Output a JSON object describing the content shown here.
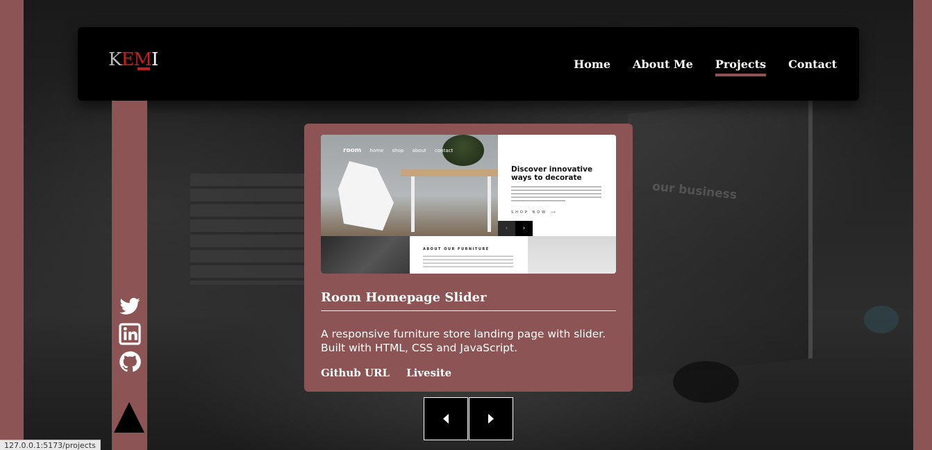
{
  "navbar": {
    "logo_letters": [
      "K",
      "E",
      "M",
      "I"
    ],
    "links": [
      {
        "label": "Home",
        "active": false
      },
      {
        "label": "About Me",
        "active": false
      },
      {
        "label": "Projects",
        "active": true
      },
      {
        "label": "Contact",
        "active": false
      }
    ]
  },
  "social": {
    "icons": [
      "twitter-icon",
      "linkedin-icon",
      "github-icon"
    ]
  },
  "background": {
    "overlay_text": "our business"
  },
  "project": {
    "title": "Room Homepage Slider",
    "description": "A responsive furniture store landing page with slider. Built with HTML, CSS and JavaScript.",
    "links": {
      "github": "Github URL",
      "livesite": "Livesite"
    },
    "preview": {
      "brand": "room",
      "nav_items": [
        "home",
        "shop",
        "about",
        "contact"
      ],
      "heading": "Discover innovative ways to decorate",
      "cta": "SHOP NOW",
      "about_heading": "ABOUT OUR FURNITURE"
    }
  },
  "slider": {
    "prev_icon": "caret-left-icon",
    "next_icon": "caret-right-icon"
  },
  "status_bar": {
    "url": "127.0.0.1:5173/projects"
  },
  "colors": {
    "accent": "#8c5454",
    "navbar_bg": "#000000",
    "logo_red": "#c02020"
  }
}
